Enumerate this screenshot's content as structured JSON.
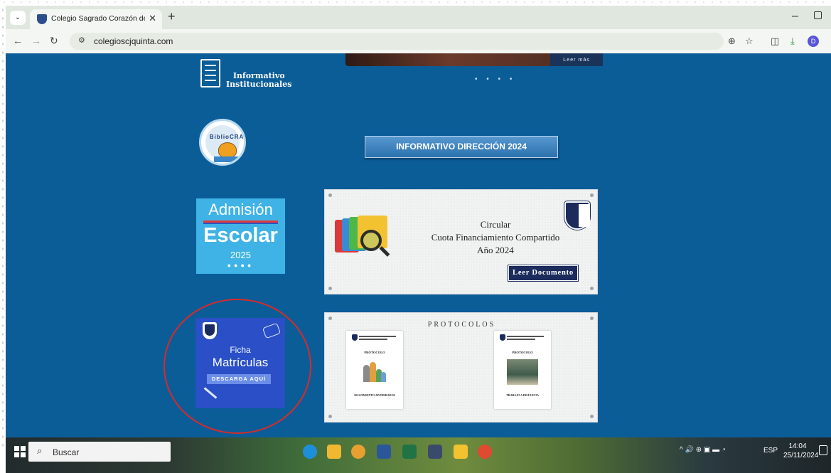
{
  "browser": {
    "tab_title": "Colegio Sagrado Corazón de Je",
    "url": "colegioscjquinta.com",
    "profile_initial": "D"
  },
  "page": {
    "hero_button": "Leer más",
    "carousel_dots": "• • • •",
    "informativo_line1": "Informativo",
    "informativo_line2": "Institucionales",
    "biblio_label": "BiblioCRA",
    "informativo_direccion": "INFORMATIVO DIRECCIÓN 2024",
    "admision": {
      "line1": "Admisión",
      "line2": "Escolar",
      "year": "2025"
    },
    "circular": {
      "line1": "Circular",
      "line2": "Cuota Financiamiento Compartido",
      "line3": "Año 2024",
      "button": "Leer Documento"
    },
    "ficha": {
      "line1": "Ficha",
      "line2": "Matrículas",
      "button": "DESCARGA AQUÍ"
    },
    "protocolos": {
      "title": "PROTOCOLOS",
      "doc1_head": "PROTOCOLO",
      "doc1_foot": "SEGUIMIENTO APODERADOS",
      "doc2_head": "PROTOCOLO",
      "doc2_foot": "TRABAJO A DISTANCIA"
    }
  },
  "taskbar": {
    "search_placeholder": "Buscar",
    "language": "ESP",
    "time": "14:04",
    "date": "25/11/2024"
  },
  "colors": {
    "page_bg": "#0b5d98",
    "navy": "#1b2b5c",
    "admision_bg": "#3fb3e6",
    "ficha_bg": "#2a4fc6",
    "highlight_circle": "#d92a2a"
  }
}
